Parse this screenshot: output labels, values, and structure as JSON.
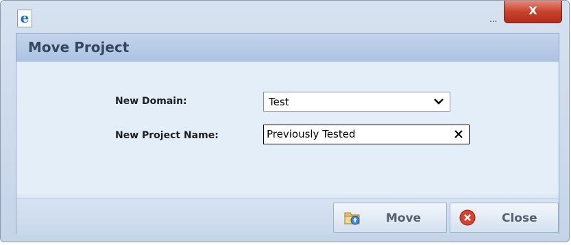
{
  "window": {
    "titlebar_ellipsis": "...",
    "close_glyph": "X",
    "icon_glyph": "e"
  },
  "dialog": {
    "title": "Move Project",
    "domain_label": "New Domain:",
    "domain_value": "Test",
    "project_name_label": "New Project Name:",
    "project_name_value": "Previously Tested"
  },
  "buttons": {
    "move_label": "Move",
    "close_label": "Close"
  },
  "colors": {
    "header_text": "#33475f",
    "close_button_red": "#c8432e"
  }
}
